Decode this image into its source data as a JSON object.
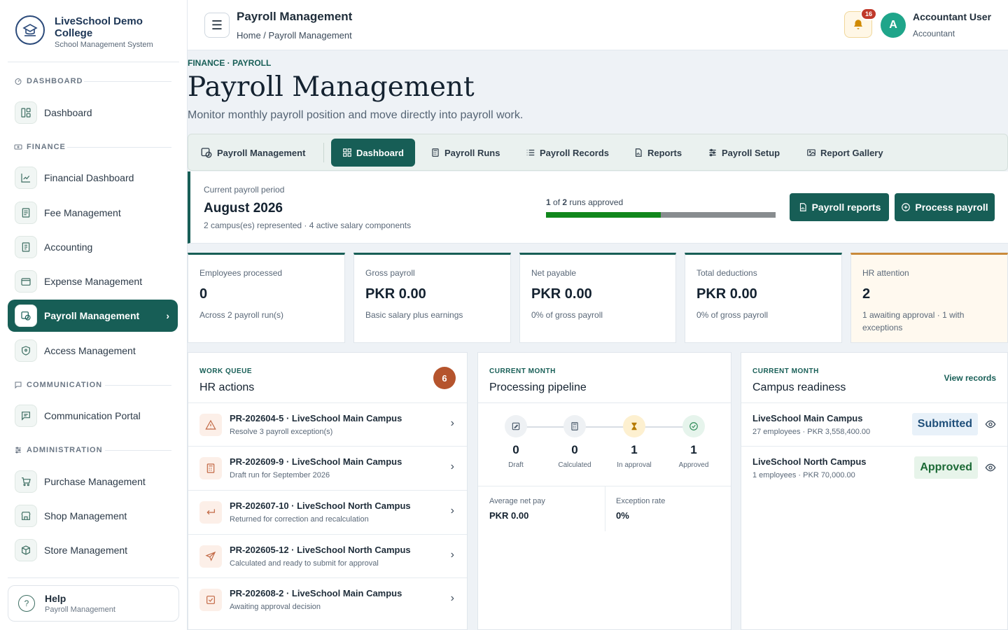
{
  "sidebar": {
    "brand_name": "LiveSchool Demo College",
    "brand_sub": "School Management System",
    "sections": {
      "dashboard": "DASHBOARD",
      "finance": "FINANCE",
      "communication": "COMMUNICATION",
      "administration": "ADMINISTRATION"
    },
    "items": {
      "dashboard": "Dashboard",
      "financial_dashboard": "Financial Dashboard",
      "fee_management": "Fee Management",
      "accounting": "Accounting",
      "expense_management": "Expense Management",
      "payroll_management": "Payroll Management",
      "access_management": "Access Management",
      "communication_portal": "Communication Portal",
      "purchase_management": "Purchase Management",
      "shop_management": "Shop Management",
      "store_management": "Store Management"
    },
    "help": {
      "title": "Help",
      "sub": "Payroll Management"
    }
  },
  "topbar": {
    "title": "Payroll Management",
    "breadcrumb": "Home / Payroll Management",
    "notif_count": "16",
    "avatar_initial": "A",
    "user_name": "Accountant User",
    "user_role": "Accountant"
  },
  "page": {
    "eyebrow": "FINANCE · PAYROLL",
    "title": "Payroll Management",
    "subtitle": "Monitor monthly payroll position and move directly into payroll work."
  },
  "tabs": {
    "module": "Payroll Management",
    "dashboard": "Dashboard",
    "runs": "Payroll Runs",
    "records": "Payroll Records",
    "reports": "Reports",
    "setup": "Payroll Setup",
    "gallery": "Report Gallery"
  },
  "period": {
    "label": "Current payroll period",
    "month": "August 2026",
    "meta": "2 campus(es) represented · 4 active salary components",
    "approved": "1",
    "of_text": "of",
    "total": "2",
    "runs_text": "runs approved",
    "progress_fraction": 0.5,
    "btn_reports": "Payroll reports",
    "btn_process": "Process payroll"
  },
  "kpis": [
    {
      "label": "Employees processed",
      "value": "0",
      "note": "Across 2 payroll run(s)"
    },
    {
      "label": "Gross payroll",
      "value": "PKR 0.00",
      "note": "Basic salary plus earnings"
    },
    {
      "label": "Net payable",
      "value": "PKR 0.00",
      "note": "0% of gross payroll"
    },
    {
      "label": "Total deductions",
      "value": "PKR 0.00",
      "note": "0% of gross payroll"
    },
    {
      "label": "HR attention",
      "value": "2",
      "note": "1 awaiting approval · 1 with exceptions"
    }
  ],
  "queue": {
    "eyebrow": "WORK QUEUE",
    "title": "HR actions",
    "count": "6",
    "items": [
      {
        "title": "PR-202604-5 · LiveSchool Main Campus",
        "sub": "Resolve 3 payroll exception(s)",
        "icon": "warning-icon"
      },
      {
        "title": "PR-202609-9 · LiveSchool Main Campus",
        "sub": "Draft run for September 2026",
        "icon": "calculator-icon"
      },
      {
        "title": "PR-202607-10 · LiveSchool North Campus",
        "sub": "Returned for correction and recalculation",
        "icon": "return-icon"
      },
      {
        "title": "PR-202605-12 · LiveSchool North Campus",
        "sub": "Calculated and ready to submit for approval",
        "icon": "send-icon"
      },
      {
        "title": "PR-202608-2 · LiveSchool Main Campus",
        "sub": "Awaiting approval decision",
        "icon": "checkbox-icon"
      }
    ]
  },
  "pipeline": {
    "eyebrow": "CURRENT MONTH",
    "title": "Processing pipeline",
    "steps": [
      {
        "value": "0",
        "label": "Draft"
      },
      {
        "value": "0",
        "label": "Calculated"
      },
      {
        "value": "1",
        "label": "In approval"
      },
      {
        "value": "1",
        "label": "Approved"
      }
    ],
    "avg_label": "Average net pay",
    "avg_value": "PKR 0.00",
    "exc_label": "Exception rate",
    "exc_value": "0%"
  },
  "campus": {
    "eyebrow": "CURRENT MONTH",
    "title": "Campus readiness",
    "link": "View records",
    "items": [
      {
        "name": "LiveSchool Main Campus",
        "sub": "27 employees · PKR 3,558,400.00",
        "status": "Submitted"
      },
      {
        "name": "LiveSchool North Campus",
        "sub": "1 employees · PKR 70,000.00",
        "status": "Approved"
      }
    ]
  },
  "colors": {
    "primary": "#175e56",
    "accent_warn": "#c98a3a",
    "badge": "#c0392b",
    "progress": "#11871c"
  }
}
